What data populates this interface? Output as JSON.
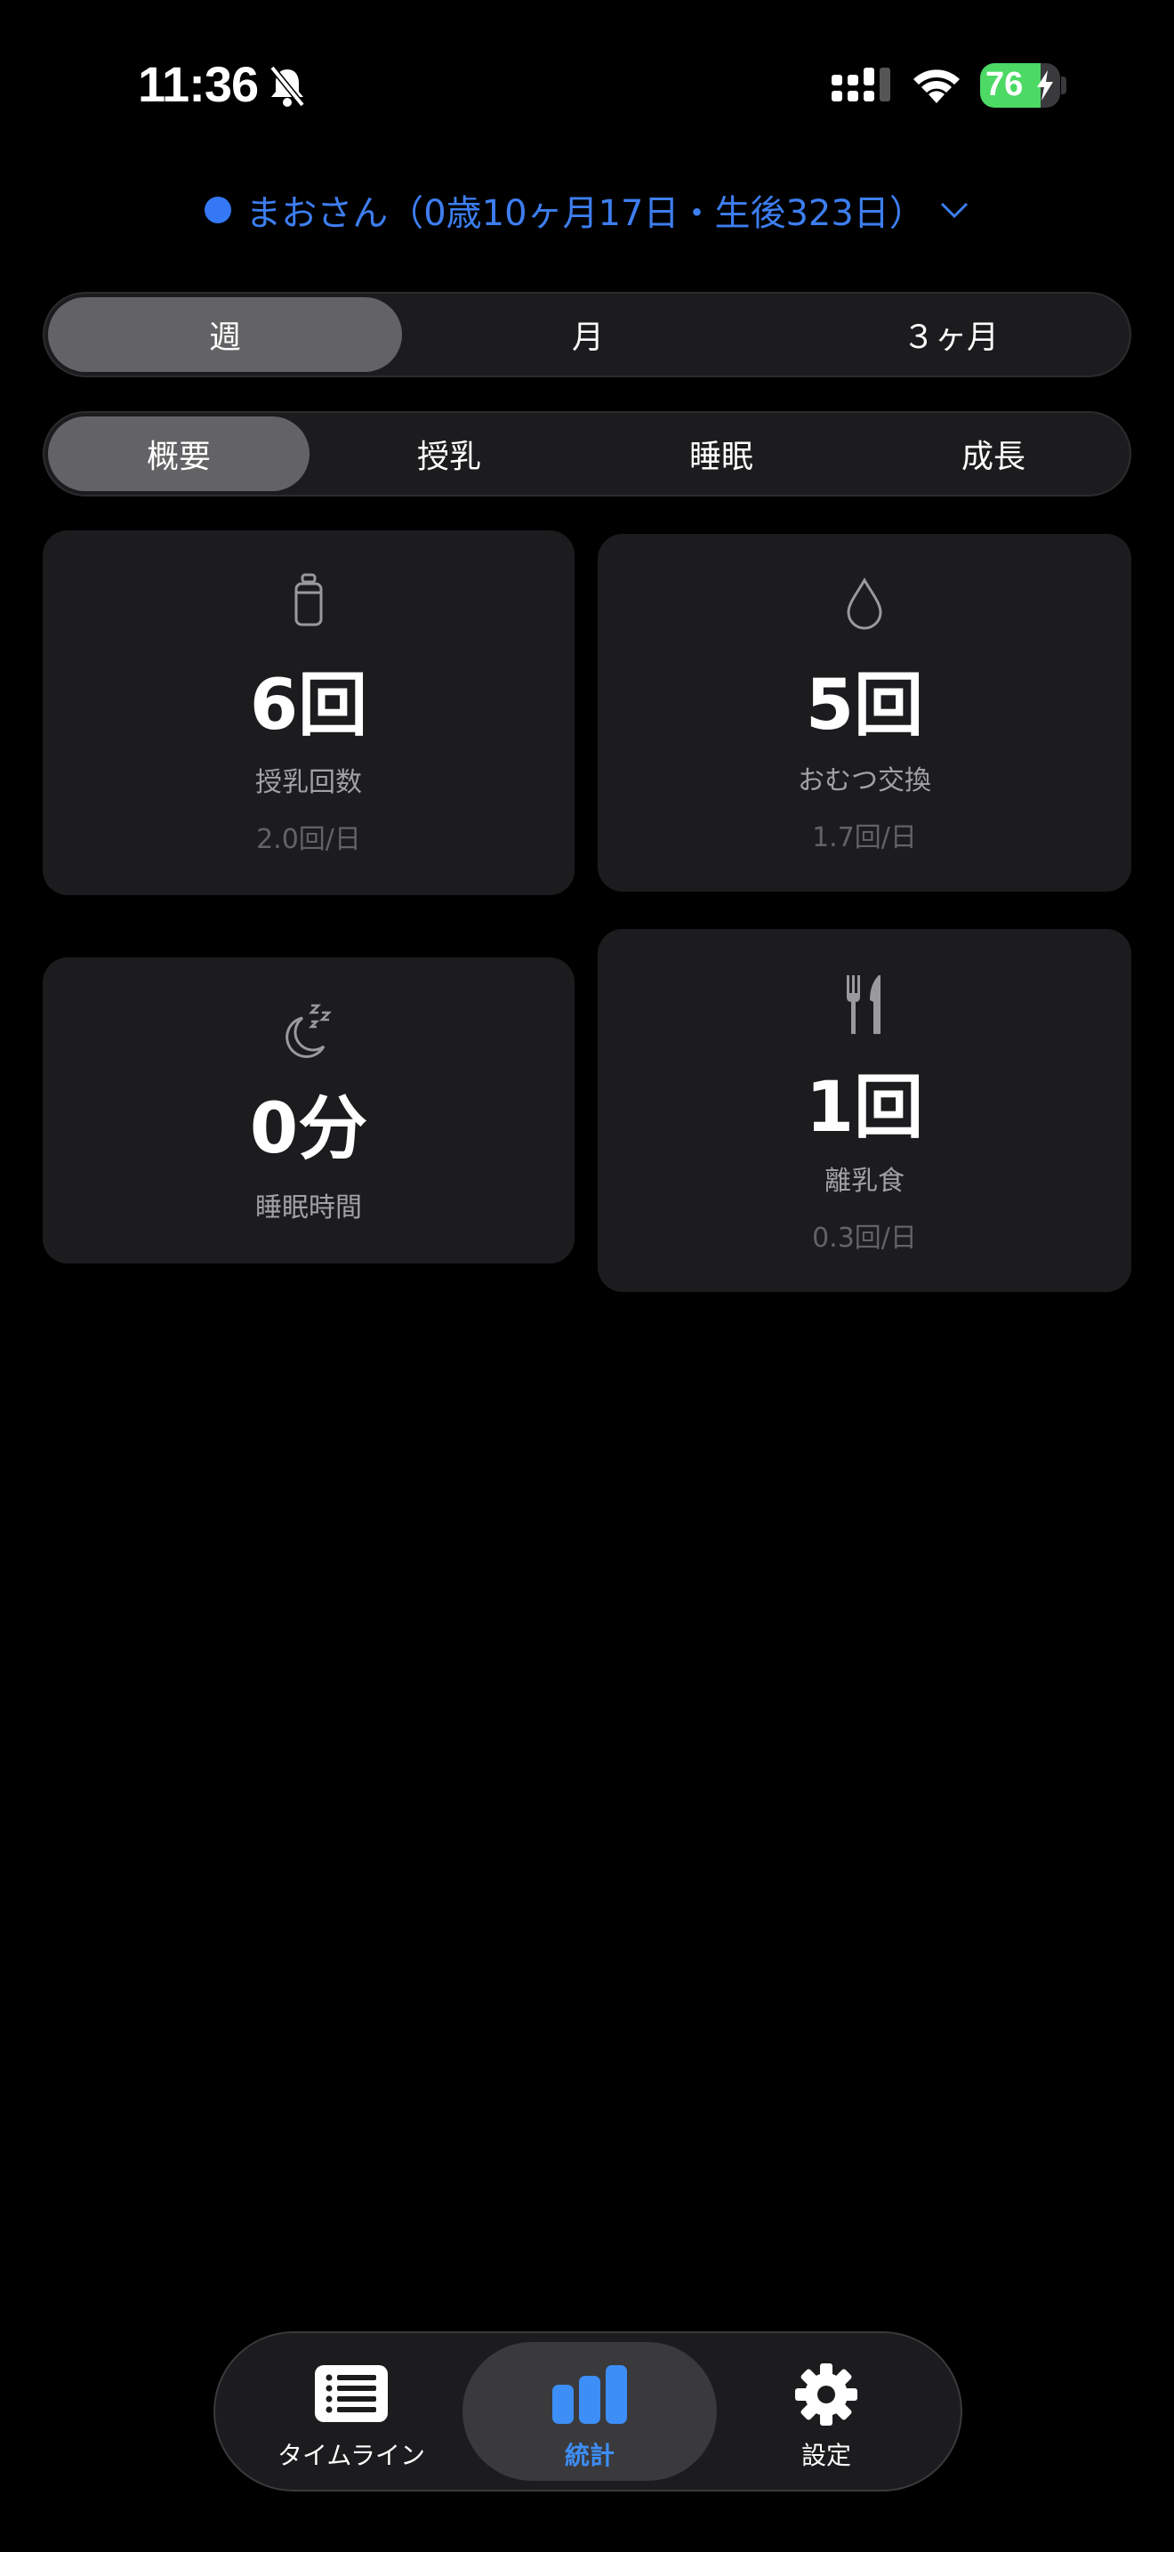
{
  "status_bar": {
    "time": "11:36",
    "battery_level": "76",
    "battery_fraction": 0.76
  },
  "child": {
    "name_label": "まおさん（0歳10ヶ月17日・生後323日）"
  },
  "period_tabs": [
    {
      "label": "週",
      "active": true
    },
    {
      "label": "月",
      "active": false
    },
    {
      "label": "３ヶ月",
      "active": false
    }
  ],
  "category_tabs": [
    {
      "label": "概要",
      "active": true
    },
    {
      "label": "授乳",
      "active": false
    },
    {
      "label": "睡眠",
      "active": false
    },
    {
      "label": "成長",
      "active": false
    }
  ],
  "cards": {
    "feeding": {
      "icon": "bottle-icon",
      "value": "6回",
      "label": "授乳回数",
      "sub": "2.0回/日"
    },
    "diaper": {
      "icon": "drop-icon",
      "value": "5回",
      "label": "おむつ交換",
      "sub": "1.7回/日"
    },
    "sleep": {
      "icon": "moon-zzz-icon",
      "value": "0分",
      "label": "睡眠時間"
    },
    "baby_food": {
      "icon": "fork-knife-icon",
      "value": "1回",
      "label": "離乳食",
      "sub": "0.3回/日"
    }
  },
  "tab_bar": {
    "items": [
      {
        "label": "タイムライン",
        "icon": "list-icon",
        "active": false
      },
      {
        "label": "統計",
        "icon": "bar-chart-icon",
        "active": true
      },
      {
        "label": "設定",
        "icon": "gear-icon",
        "active": false
      }
    ]
  },
  "colors": {
    "accent": "#3d7ef0",
    "battery": "#4cd964",
    "card_bg": "#1c1c1e"
  }
}
